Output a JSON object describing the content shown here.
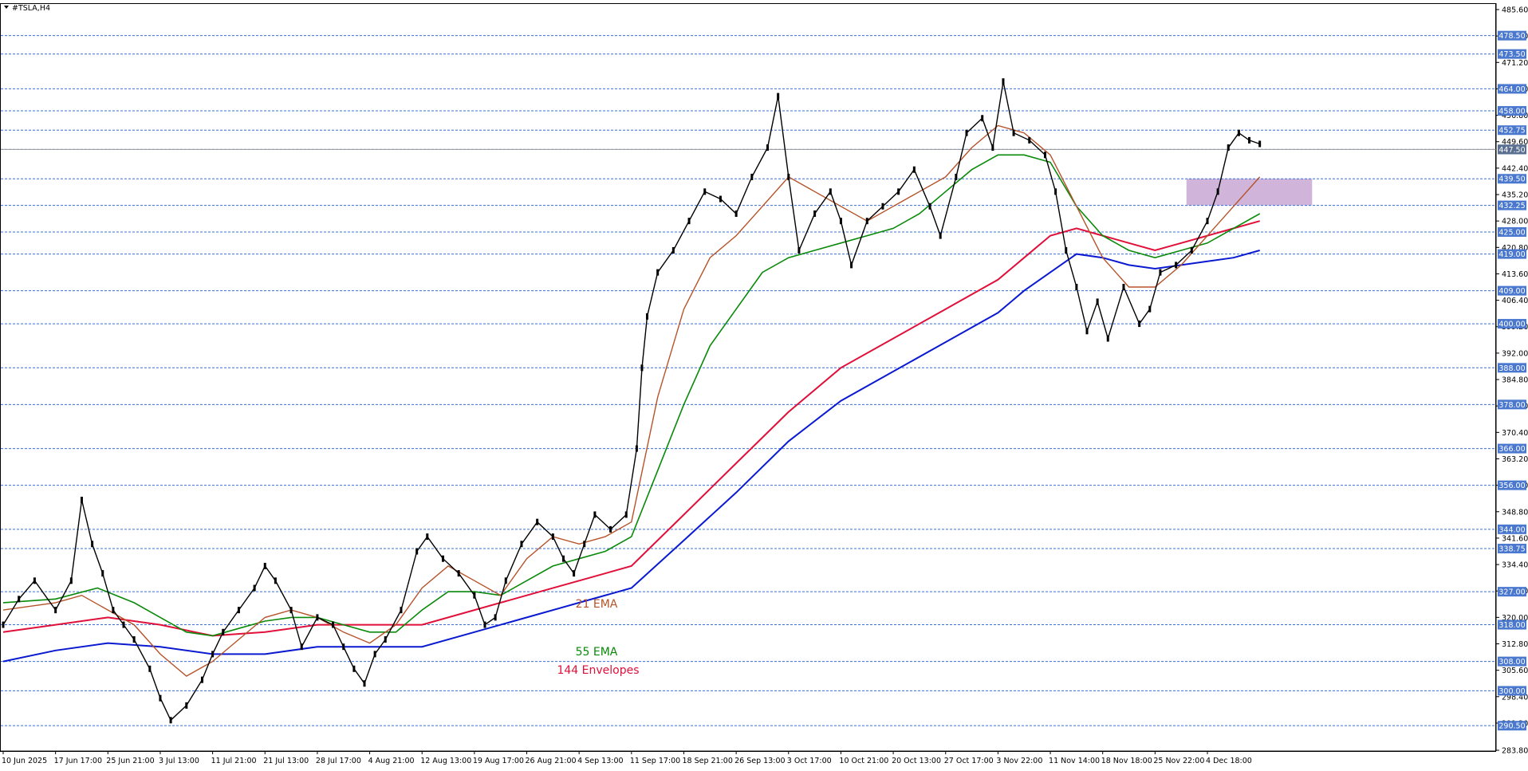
{
  "window": {
    "title": "#TSLA,H4"
  },
  "colors": {
    "background": "#ffffff",
    "candle": "#000000",
    "grid_dash": "#3a6fd8",
    "label_bg": "#4a78cf",
    "label_text": "#ffffff",
    "ema21": "#b5532a",
    "ema55": "#0a8a0a",
    "env_upper": "#e0103a",
    "env_lower": "#0a1ad0",
    "zone": "#c9a7d3"
  },
  "chart_data": {
    "type": "line",
    "symbol": "#TSLA",
    "timeframe": "H4",
    "ylim": [
      283.8,
      485.6
    ],
    "y_ticks": [
      "485.60",
      "478.40",
      "471.20",
      "464.00",
      "456.80",
      "449.60",
      "442.40",
      "435.20",
      "428.00",
      "420.80",
      "413.60",
      "406.40",
      "399.20",
      "392.00",
      "384.80",
      "377.60",
      "370.40",
      "363.20",
      "356.00",
      "348.80",
      "341.60",
      "334.40",
      "327.20",
      "320.00",
      "312.80",
      "305.60",
      "298.40",
      "291.20",
      "283.80"
    ],
    "x_tick_labels": [
      "10 Jun 2025",
      "17 Jun 17:00",
      "25 Jun 21:00",
      "3 Jul 13:00",
      "11 Jul 21:00",
      "21 Jul 13:00",
      "28 Jul 17:00",
      "4 Aug 21:00",
      "12 Aug 13:00",
      "19 Aug 17:00",
      "26 Aug 21:00",
      "4 Sep 13:00",
      "11 Sep 17:00",
      "18 Sep 21:00",
      "26 Sep 13:00",
      "3 Oct 17:00",
      "10 Oct 21:00",
      "20 Oct 13:00",
      "27 Oct 17:00",
      "3 Nov 22:00",
      "11 Nov 14:00",
      "18 Nov 18:00",
      "25 Nov 22:00",
      "4 Dec 18:00"
    ],
    "horizontal_levels": [
      "478.50",
      "473.50",
      "464.00",
      "458.00",
      "452.75",
      "447.50",
      "439.50",
      "432.25",
      "425.00",
      "419.00",
      "409.00",
      "400.00",
      "388.00",
      "378.00",
      "366.00",
      "356.00",
      "344.00",
      "338.75",
      "327.00",
      "318.00",
      "308.00",
      "300.00",
      "290.50"
    ],
    "current_price": "447.50",
    "zone": {
      "low": 432.25,
      "high": 439.5,
      "from_index": 22.6,
      "to_index": 25.0
    },
    "legend": [
      {
        "name": "21 EMA",
        "color": "#b5532a"
      },
      {
        "name": "55 EMA",
        "color": "#0a8a0a"
      },
      {
        "name": "144 Envelopes",
        "color": "#e0103a"
      }
    ],
    "price_path": [
      [
        0,
        318
      ],
      [
        0.3,
        325
      ],
      [
        0.6,
        330
      ],
      [
        1.0,
        322
      ],
      [
        1.3,
        330
      ],
      [
        1.5,
        352
      ],
      [
        1.7,
        340
      ],
      [
        1.9,
        332
      ],
      [
        2.1,
        322
      ],
      [
        2.3,
        318
      ],
      [
        2.5,
        314
      ],
      [
        2.8,
        306
      ],
      [
        3.0,
        298
      ],
      [
        3.2,
        292
      ],
      [
        3.5,
        296
      ],
      [
        3.8,
        303
      ],
      [
        4.0,
        310
      ],
      [
        4.2,
        316
      ],
      [
        4.5,
        322
      ],
      [
        4.8,
        328
      ],
      [
        5.0,
        334
      ],
      [
        5.2,
        330
      ],
      [
        5.5,
        322
      ],
      [
        5.7,
        312
      ],
      [
        6.0,
        320
      ],
      [
        6.3,
        318
      ],
      [
        6.5,
        312
      ],
      [
        6.7,
        306
      ],
      [
        6.9,
        302
      ],
      [
        7.1,
        310
      ],
      [
        7.3,
        314
      ],
      [
        7.6,
        322
      ],
      [
        7.9,
        338
      ],
      [
        8.1,
        342
      ],
      [
        8.4,
        336
      ],
      [
        8.7,
        332
      ],
      [
        9.0,
        326
      ],
      [
        9.2,
        318
      ],
      [
        9.4,
        320
      ],
      [
        9.6,
        330
      ],
      [
        9.9,
        340
      ],
      [
        10.2,
        346
      ],
      [
        10.5,
        342
      ],
      [
        10.7,
        336
      ],
      [
        10.9,
        332
      ],
      [
        11.1,
        340
      ],
      [
        11.3,
        348
      ],
      [
        11.6,
        344
      ],
      [
        11.9,
        348
      ],
      [
        12.1,
        366
      ],
      [
        12.2,
        388
      ],
      [
        12.3,
        402
      ],
      [
        12.5,
        414
      ],
      [
        12.8,
        420
      ],
      [
        13.1,
        428
      ],
      [
        13.4,
        436
      ],
      [
        13.7,
        434
      ],
      [
        14.0,
        430
      ],
      [
        14.3,
        440
      ],
      [
        14.6,
        448
      ],
      [
        14.8,
        462
      ],
      [
        15.0,
        440
      ],
      [
        15.2,
        420
      ],
      [
        15.5,
        430
      ],
      [
        15.8,
        436
      ],
      [
        16.0,
        428
      ],
      [
        16.2,
        416
      ],
      [
        16.5,
        428
      ],
      [
        16.8,
        432
      ],
      [
        17.1,
        436
      ],
      [
        17.4,
        442
      ],
      [
        17.7,
        432
      ],
      [
        17.9,
        424
      ],
      [
        18.2,
        440
      ],
      [
        18.4,
        452
      ],
      [
        18.7,
        456
      ],
      [
        18.9,
        448
      ],
      [
        19.1,
        466
      ],
      [
        19.3,
        452
      ],
      [
        19.6,
        450
      ],
      [
        19.9,
        446
      ],
      [
        20.1,
        436
      ],
      [
        20.3,
        420
      ],
      [
        20.5,
        410
      ],
      [
        20.7,
        398
      ],
      [
        20.9,
        406
      ],
      [
        21.1,
        396
      ],
      [
        21.4,
        410
      ],
      [
        21.7,
        400
      ],
      [
        21.9,
        404
      ],
      [
        22.1,
        414
      ],
      [
        22.4,
        416
      ],
      [
        22.7,
        420
      ],
      [
        23.0,
        428
      ],
      [
        23.2,
        436
      ],
      [
        23.4,
        448
      ],
      [
        23.6,
        452
      ],
      [
        23.8,
        450
      ],
      [
        24.0,
        449
      ]
    ],
    "ema21_path": [
      [
        0,
        322
      ],
      [
        1.0,
        324
      ],
      [
        1.5,
        326
      ],
      [
        2.0,
        322
      ],
      [
        2.5,
        318
      ],
      [
        3.0,
        310
      ],
      [
        3.5,
        304
      ],
      [
        4.0,
        308
      ],
      [
        4.5,
        314
      ],
      [
        5.0,
        320
      ],
      [
        5.5,
        322
      ],
      [
        6.0,
        320
      ],
      [
        6.5,
        316
      ],
      [
        7.0,
        313
      ],
      [
        7.5,
        318
      ],
      [
        8.0,
        328
      ],
      [
        8.5,
        334
      ],
      [
        9.0,
        330
      ],
      [
        9.5,
        326
      ],
      [
        10.0,
        336
      ],
      [
        10.5,
        342
      ],
      [
        11.0,
        340
      ],
      [
        11.5,
        342
      ],
      [
        12.0,
        346
      ],
      [
        12.5,
        380
      ],
      [
        13.0,
        404
      ],
      [
        13.5,
        418
      ],
      [
        14.0,
        424
      ],
      [
        14.5,
        432
      ],
      [
        15.0,
        440
      ],
      [
        15.5,
        436
      ],
      [
        16.0,
        432
      ],
      [
        16.5,
        428
      ],
      [
        17.0,
        432
      ],
      [
        17.5,
        436
      ],
      [
        18.0,
        440
      ],
      [
        18.5,
        448
      ],
      [
        19.0,
        454
      ],
      [
        19.5,
        452
      ],
      [
        20.0,
        446
      ],
      [
        20.5,
        432
      ],
      [
        21.0,
        418
      ],
      [
        21.5,
        410
      ],
      [
        22.0,
        410
      ],
      [
        22.5,
        416
      ],
      [
        23.0,
        424
      ],
      [
        23.5,
        432
      ],
      [
        24.0,
        440
      ]
    ],
    "ema55_path": [
      [
        0,
        324
      ],
      [
        1.0,
        325
      ],
      [
        1.8,
        328
      ],
      [
        2.5,
        324
      ],
      [
        3.0,
        320
      ],
      [
        3.5,
        316
      ],
      [
        4.0,
        315
      ],
      [
        4.5,
        317
      ],
      [
        5.0,
        319
      ],
      [
        5.5,
        320
      ],
      [
        6.0,
        320
      ],
      [
        6.5,
        318
      ],
      [
        7.0,
        316
      ],
      [
        7.5,
        316
      ],
      [
        8.0,
        322
      ],
      [
        8.5,
        327
      ],
      [
        9.0,
        327
      ],
      [
        9.5,
        326
      ],
      [
        10.0,
        330
      ],
      [
        10.5,
        334
      ],
      [
        11.0,
        336
      ],
      [
        11.5,
        338
      ],
      [
        12.0,
        342
      ],
      [
        12.5,
        360
      ],
      [
        13.0,
        378
      ],
      [
        13.5,
        394
      ],
      [
        14.0,
        404
      ],
      [
        14.5,
        414
      ],
      [
        15.0,
        418
      ],
      [
        15.5,
        420
      ],
      [
        16.0,
        422
      ],
      [
        16.5,
        424
      ],
      [
        17.0,
        426
      ],
      [
        17.5,
        430
      ],
      [
        18.0,
        436
      ],
      [
        18.5,
        442
      ],
      [
        19.0,
        446
      ],
      [
        19.5,
        446
      ],
      [
        20.0,
        444
      ],
      [
        20.5,
        432
      ],
      [
        21.0,
        424
      ],
      [
        21.5,
        420
      ],
      [
        22.0,
        418
      ],
      [
        22.5,
        420
      ],
      [
        23.0,
        422
      ],
      [
        23.5,
        426
      ],
      [
        24.0,
        430
      ]
    ],
    "env_upper_path": [
      [
        0,
        316
      ],
      [
        1.0,
        318
      ],
      [
        2.0,
        320
      ],
      [
        3.0,
        318
      ],
      [
        4.0,
        315
      ],
      [
        5.0,
        316
      ],
      [
        6.0,
        318
      ],
      [
        7.0,
        318
      ],
      [
        8.0,
        318
      ],
      [
        9.0,
        322
      ],
      [
        10.0,
        326
      ],
      [
        11.0,
        330
      ],
      [
        12.0,
        334
      ],
      [
        13.0,
        348
      ],
      [
        14.0,
        362
      ],
      [
        15.0,
        376
      ],
      [
        16.0,
        388
      ],
      [
        17.0,
        396
      ],
      [
        18.0,
        404
      ],
      [
        19.0,
        412
      ],
      [
        19.5,
        418
      ],
      [
        20.0,
        424
      ],
      [
        20.5,
        426
      ],
      [
        21.0,
        424
      ],
      [
        21.5,
        422
      ],
      [
        22.0,
        420
      ],
      [
        22.5,
        422
      ],
      [
        23.0,
        424
      ],
      [
        23.5,
        426
      ],
      [
        24.0,
        428
      ]
    ],
    "env_lower_path": [
      [
        0,
        308
      ],
      [
        1.0,
        311
      ],
      [
        2.0,
        313
      ],
      [
        3.0,
        312
      ],
      [
        4.0,
        310
      ],
      [
        5.0,
        310
      ],
      [
        6.0,
        312
      ],
      [
        7.0,
        312
      ],
      [
        8.0,
        312
      ],
      [
        9.0,
        316
      ],
      [
        10.0,
        320
      ],
      [
        11.0,
        324
      ],
      [
        12.0,
        328
      ],
      [
        13.0,
        341
      ],
      [
        14.0,
        354
      ],
      [
        15.0,
        368
      ],
      [
        16.0,
        379
      ],
      [
        17.0,
        387
      ],
      [
        18.0,
        395
      ],
      [
        19.0,
        403
      ],
      [
        19.5,
        409
      ],
      [
        20.0,
        414
      ],
      [
        20.5,
        419
      ],
      [
        21.0,
        418
      ],
      [
        21.5,
        416
      ],
      [
        22.0,
        415
      ],
      [
        22.5,
        416
      ],
      [
        23.0,
        417
      ],
      [
        23.5,
        418
      ],
      [
        24.0,
        420
      ]
    ]
  }
}
